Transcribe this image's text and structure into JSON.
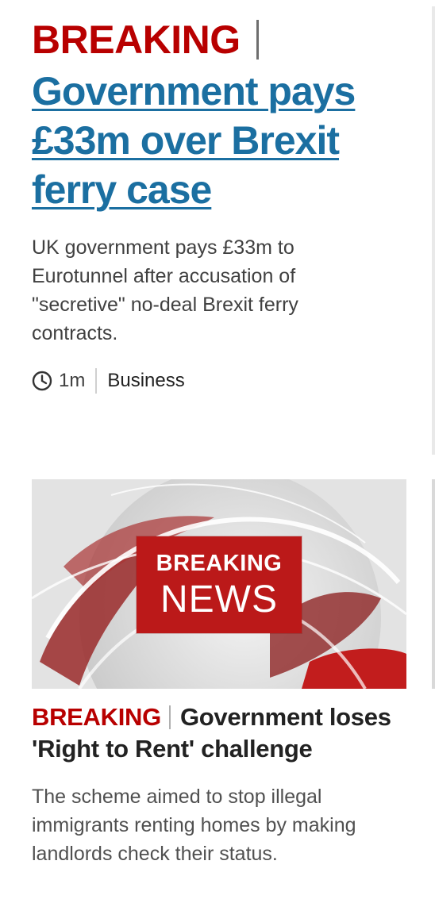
{
  "story1": {
    "kicker": "BREAKING",
    "headline": "Government pays £33m over Brexit ferry case",
    "summary": "UK government pays £33m to Eurotunnel after accusation of \"secretive\" no-deal Brexit ferry contracts.",
    "time": "1m",
    "section": "Business",
    "time_icon": "clock-icon"
  },
  "story2": {
    "image": {
      "line1": "BREAKING",
      "line2": "NEWS",
      "icon": "breaking-news-graphic"
    },
    "kicker": "BREAKING",
    "headline": "Government loses 'Right to Rent' challenge",
    "summary": "The scheme aimed to stop illegal immigrants renting homes by making landlords check their status."
  },
  "colors": {
    "breaking_red": "#b80000",
    "link_blue": "#1b6fa1",
    "banner_red": "#bb1919",
    "text_dark": "#222222",
    "text_grey": "#404040"
  }
}
